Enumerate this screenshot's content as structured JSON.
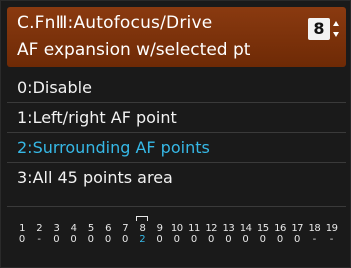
{
  "header": {
    "title": "C.FnⅢ:Autofocus/Drive",
    "subtitle": "AF expansion w/selected pt",
    "fn_number": "8"
  },
  "options": [
    {
      "label": "0:Disable",
      "selected": false
    },
    {
      "label": "1:Left/right AF point",
      "selected": false
    },
    {
      "label": "2:Surrounding AF points",
      "selected": true
    },
    {
      "label": "3:All 45 points area",
      "selected": false
    }
  ],
  "colors": {
    "header_bg": "#7a3009",
    "selected_text": "#36b8e6",
    "text": "#f2f2f2"
  },
  "settings_strip": {
    "current_index": 7,
    "items": [
      {
        "num": "1",
        "value": "0"
      },
      {
        "num": "2",
        "value": "-"
      },
      {
        "num": "3",
        "value": "0"
      },
      {
        "num": "4",
        "value": "0"
      },
      {
        "num": "5",
        "value": "0"
      },
      {
        "num": "6",
        "value": "0"
      },
      {
        "num": "7",
        "value": "0"
      },
      {
        "num": "8",
        "value": "2"
      },
      {
        "num": "9",
        "value": "0"
      },
      {
        "num": "10",
        "value": "0"
      },
      {
        "num": "11",
        "value": "0"
      },
      {
        "num": "12",
        "value": "0"
      },
      {
        "num": "13",
        "value": "0"
      },
      {
        "num": "14",
        "value": "0"
      },
      {
        "num": "15",
        "value": "0"
      },
      {
        "num": "16",
        "value": "0"
      },
      {
        "num": "17",
        "value": "0"
      },
      {
        "num": "18",
        "value": "-"
      },
      {
        "num": "19",
        "value": "-"
      }
    ]
  }
}
